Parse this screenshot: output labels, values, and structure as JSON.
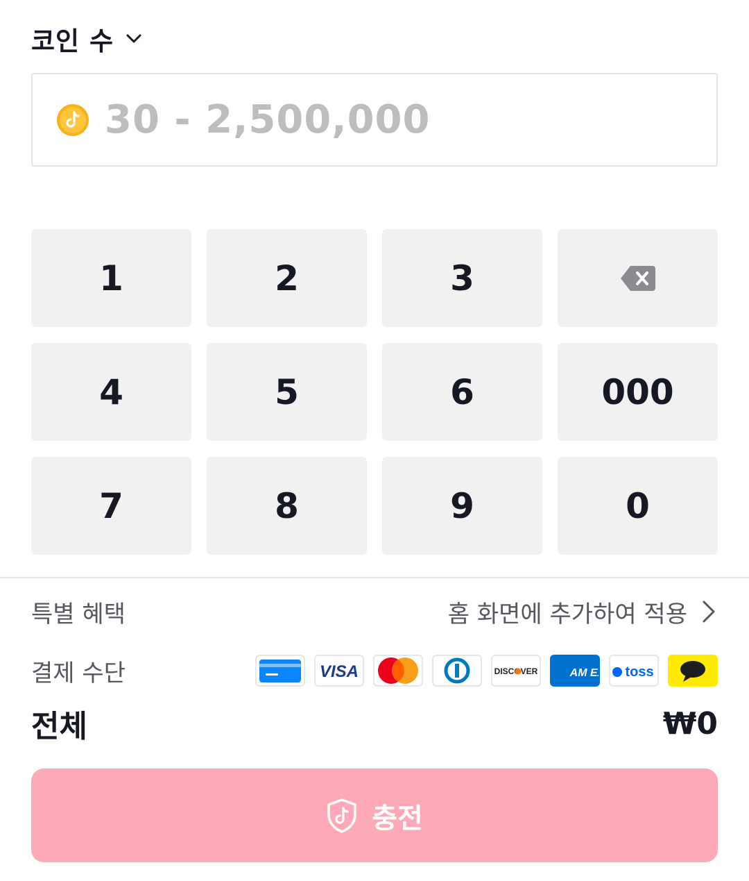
{
  "header": {
    "title": "코인 수",
    "dropdown_icon": "chevron-down-icon"
  },
  "amount": {
    "placeholder": "30 - 2,500,000",
    "value": "",
    "icon": "coin-icon"
  },
  "keypad": {
    "keys": [
      "1",
      "2",
      "3",
      "",
      "4",
      "5",
      "6",
      "000",
      "7",
      "8",
      "9",
      "0"
    ],
    "backspace_icon": "backspace-icon"
  },
  "promo": {
    "label": "특별 혜택",
    "link_text": "홈 화면에 추가하여 적용",
    "link_icon": "chevron-right-icon"
  },
  "payment": {
    "label": "결제 수단",
    "methods": [
      "card-icon",
      "visa-icon",
      "mastercard-icon",
      "diners-icon",
      "discover-icon",
      "amex-icon",
      "toss-icon",
      "kakaopay-icon"
    ],
    "method_labels": {
      "visa": "VISA",
      "discover": "DISCOVER",
      "amex": "AM EX",
      "toss": "toss"
    }
  },
  "total": {
    "label": "전체",
    "value": "₩0"
  },
  "charge_button": {
    "label": "충전",
    "icon": "shield-icon"
  },
  "colors": {
    "accent": "#fea9b8",
    "text": "#161823",
    "muted": "#57585f",
    "placeholder": "#bdbdbd",
    "key_bg": "#f1f1f2"
  }
}
